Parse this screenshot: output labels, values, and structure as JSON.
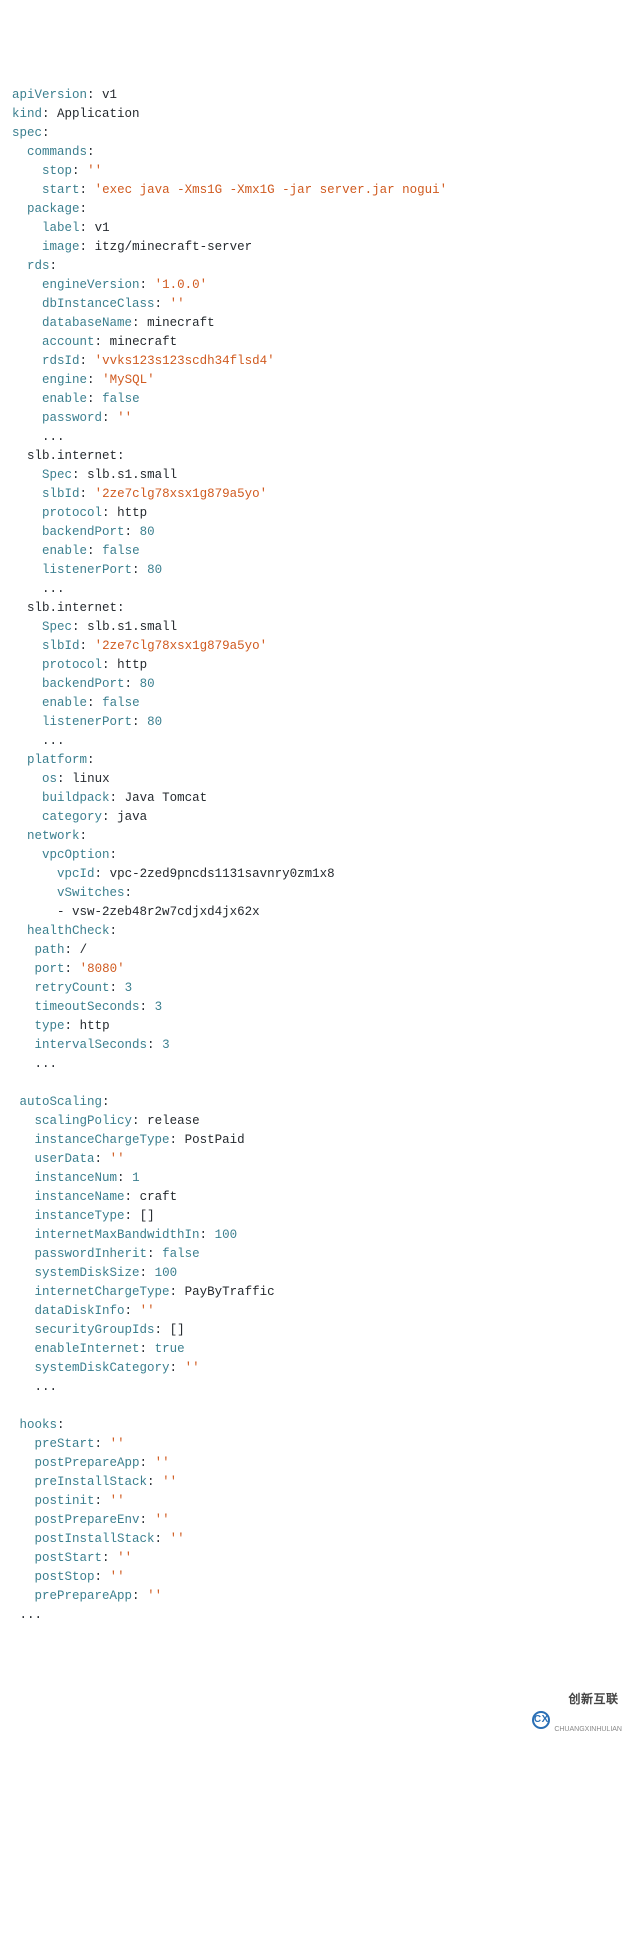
{
  "yaml": {
    "apiVersion": "v1",
    "kind": "Application",
    "spec": {
      "commands": {
        "stop": "''",
        "start": "'exec java -Xms1G -Xmx1G -jar server.jar nogui'"
      },
      "package": {
        "label": "v1",
        "image": "itzg/minecraft-server"
      },
      "rds": {
        "engineVersion": "'1.0.0'",
        "dbInstanceClass": "''",
        "databaseName": "minecraft",
        "account": "minecraft",
        "rdsId": "'vvks123s123scdh34flsd4'",
        "engine": "'MySQL'",
        "enable": "false",
        "password": "''"
      },
      "slb_internet_1": {
        "Spec": "slb.s1.small",
        "slbId": "'2ze7clg78xsx1g879a5yo'",
        "protocol": "http",
        "backendPort": "80",
        "enable": "false",
        "listenerPort": "80"
      },
      "slb_internet_2": {
        "Spec": "slb.s1.small",
        "slbId": "'2ze7clg78xsx1g879a5yo'",
        "protocol": "http",
        "backendPort": "80",
        "enable": "false",
        "listenerPort": "80"
      },
      "platform": {
        "os": "linux",
        "buildpack": "Java Tomcat",
        "category": "java"
      },
      "network": {
        "vpcOption": {
          "vpcId": "vpc-2zed9pncds1131savnry0zm1x8",
          "vSwitches_item": "vsw-2zeb48r2w7cdjxd4jx62x"
        }
      },
      "healthCheck": {
        "path": "/",
        "port": "'8080'",
        "retryCount": "3",
        "timeoutSeconds": "3",
        "type": "http",
        "intervalSeconds": "3"
      },
      "autoScaling": {
        "scalingPolicy": "release",
        "instanceChargeType": "PostPaid",
        "userData": "''",
        "instanceNum": "1",
        "instanceName": "craft",
        "instanceType": "[]",
        "internetMaxBandwidthIn": "100",
        "passwordInherit": "false",
        "systemDiskSize": "100",
        "internetChargeType": "PayByTraffic",
        "dataDiskInfo": "''",
        "securityGroupIds": "[]",
        "enableInternet": "true",
        "systemDiskCategory": "''"
      },
      "hooks": {
        "preStart": "''",
        "postPrepareApp": "''",
        "preInstallStack": "''",
        "postinit": "''",
        "postPrepareEnv": "''",
        "postInstallStack": "''",
        "postStart": "''",
        "postStop": "''",
        "prePrepareApp": "''"
      }
    }
  },
  "keys": {
    "apiVersion": "apiVersion",
    "kind": "kind",
    "spec": "spec",
    "commands": "commands",
    "stop": "stop",
    "start": "start",
    "package": "package",
    "label": "label",
    "image": "image",
    "rds": "rds",
    "engineVersion": "engineVersion",
    "dbInstanceClass": "dbInstanceClass",
    "databaseName": "databaseName",
    "account": "account",
    "rdsId": "rdsId",
    "engine": "engine",
    "enable": "enable",
    "password": "password",
    "slb_internet": "slb.internet",
    "Spec": "Spec",
    "slbId": "slbId",
    "protocol": "protocol",
    "backendPort": "backendPort",
    "listenerPort": "listenerPort",
    "platform": "platform",
    "os": "os",
    "buildpack": "buildpack",
    "category": "category",
    "network": "network",
    "vpcOption": "vpcOption",
    "vpcId": "vpcId",
    "vSwitches": "vSwitches",
    "healthCheck": "healthCheck",
    "path": "path",
    "port": "port",
    "retryCount": "retryCount",
    "timeoutSeconds": "timeoutSeconds",
    "type": "type",
    "intervalSeconds": "intervalSeconds",
    "autoScaling": "autoScaling",
    "scalingPolicy": "scalingPolicy",
    "instanceChargeType": "instanceChargeType",
    "userData": "userData",
    "instanceNum": "instanceNum",
    "instanceName": "instanceName",
    "instanceType": "instanceType",
    "internetMaxBandwidthIn": "internetMaxBandwidthIn",
    "passwordInherit": "passwordInherit",
    "systemDiskSize": "systemDiskSize",
    "internetChargeType": "internetChargeType",
    "dataDiskInfo": "dataDiskInfo",
    "securityGroupIds": "securityGroupIds",
    "enableInternet": "enableInternet",
    "systemDiskCategory": "systemDiskCategory",
    "hooks": "hooks",
    "preStart": "preStart",
    "postPrepareApp": "postPrepareApp",
    "preInstallStack": "preInstallStack",
    "postinit": "postinit",
    "postPrepareEnv": "postPrepareEnv",
    "postInstallStack": "postInstallStack",
    "postStart": "postStart",
    "postStop": "postStop",
    "prePrepareApp": "prePrepareApp"
  },
  "ellipsis": "...",
  "watermark": {
    "cn": "创新互联",
    "en": "CHUANGXINHULIAN"
  }
}
